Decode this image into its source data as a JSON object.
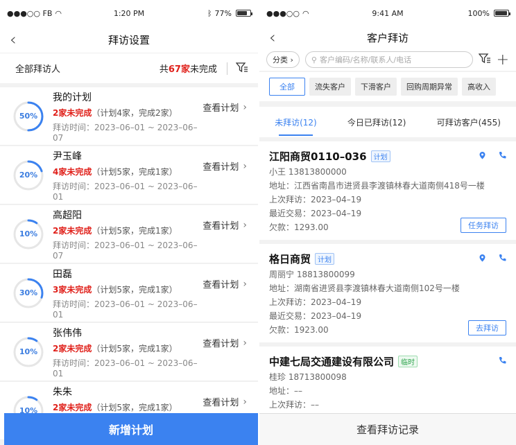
{
  "left": {
    "status": {
      "carrier": "●●●○○ FB",
      "time": "1:20 PM",
      "battery": "77%"
    },
    "title": "拜访设置",
    "summary": {
      "label": "全部拜访人",
      "prefix": "共",
      "count": "67家",
      "suffix": "未完成"
    },
    "view_label": "查看计划",
    "rows": [
      {
        "percent": "50%",
        "progress": 0.5,
        "name": "我的计划",
        "pending": "2家未完成",
        "detail": "（计划4家，完成2家）",
        "time": "拜访时间：2023–06–01 ~ 2023–06–07"
      },
      {
        "percent": "20%",
        "progress": 0.2,
        "name": "尹玉峰",
        "pending": "4家未完成",
        "detail": "（计划5家，完成1家）",
        "time": "拜访时间：2023–06–01 ~ 2023–06–01"
      },
      {
        "percent": "10%",
        "progress": 0.1,
        "name": "高超阳",
        "pending": "2家未完成",
        "detail": "（计划5家，完成1家）",
        "time": "拜访时间：2023–06–01 ~ 2023–06–07"
      },
      {
        "percent": "30%",
        "progress": 0.3,
        "name": "田磊",
        "pending": "3家未完成",
        "detail": "（计划5家，完成1家）",
        "time": "拜访时间：2023–06–01 ~ 2023–06–01"
      },
      {
        "percent": "10%",
        "progress": 0.1,
        "name": "张伟伟",
        "pending": "2家未完成",
        "detail": "（计划5家，完成1家）",
        "time": "拜访时间：2023–06–01 ~ 2023–06–01"
      },
      {
        "percent": "10%",
        "progress": 0.1,
        "name": "朱朱",
        "pending": "2家未完成",
        "detail": "（计划5家，完成1家）",
        "time": "拜访时间：2023–06–01 ~ 2023–06–01"
      }
    ],
    "add_button": "新增计划"
  },
  "right": {
    "status": {
      "carrier": "●●●○○",
      "time": "9:41 AM",
      "battery": "100%"
    },
    "title": "客户拜访",
    "category": "分类 ›",
    "search_placeholder": "客户编码/名称/联系人/电话",
    "chips": [
      "全部",
      "流失客户",
      "下滑客户",
      "回购周期异常",
      "高收入"
    ],
    "tabs": [
      "未拜访(12)",
      "今日已拜访(12)",
      "可拜访客户(455)"
    ],
    "cards": [
      {
        "name": "江阳商贸0110–036",
        "tag": "计划",
        "contact": "小王 13813800000",
        "address": "地址：江西省南昌市进贤县李渡镇林春大道南侧418号一楼",
        "last_visit": "上次拜访：2023–04–19",
        "last_trade": "最近交易：2023–04–19",
        "debt": "欠款：1293.00",
        "action": "任务拜访"
      },
      {
        "name": "格日商贸",
        "tag": "计划",
        "contact": "周丽宁 18813800099",
        "address": "地址：湖南省进贤县李渡镇林春大道南侧102号一楼",
        "last_visit": "上次拜访：2023–04–19",
        "last_trade": "最近交易：2023–04–19",
        "debt": "欠款：1923.00",
        "action": "去拜访"
      },
      {
        "name": "中建七局交通建设有限公司",
        "tag": "临时",
        "contact": "桂珍 18713800098",
        "address": "地址：––",
        "last_visit": "上次拜访：––",
        "last_trade": "最近交易：––"
      }
    ],
    "footer": "查看拜访记录"
  }
}
